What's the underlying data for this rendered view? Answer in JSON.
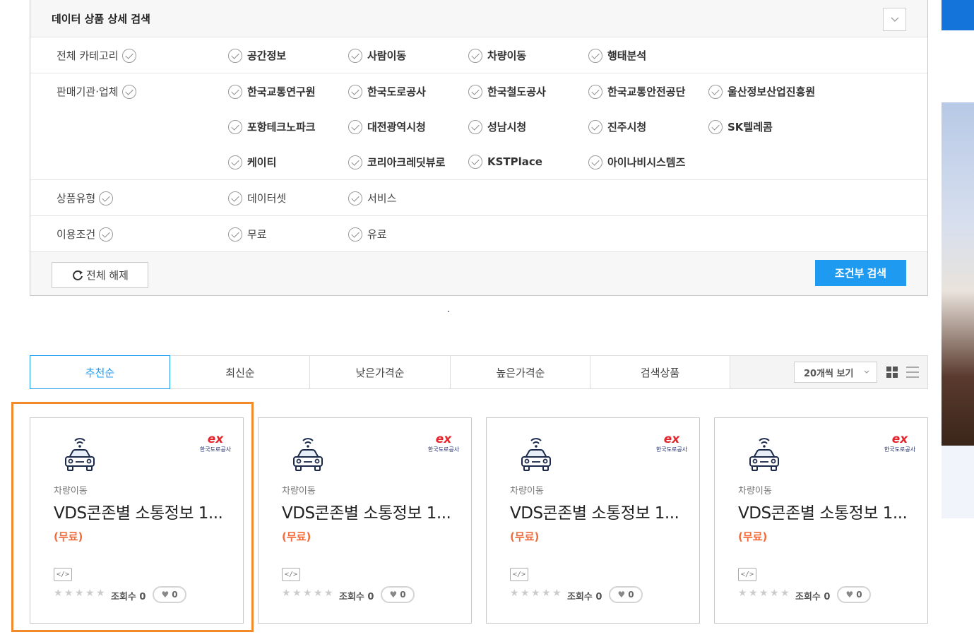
{
  "filter": {
    "title": "데이터 상품 상세 검색",
    "rows": [
      {
        "label": "전체 카테고리",
        "options": [
          "공간정보",
          "사람이동",
          "차량이동",
          "행태분석"
        ]
      },
      {
        "label": "판매기관·업체",
        "options": [
          "한국교통연구원",
          "한국도로공사",
          "한국철도공사",
          "한국교통안전공단",
          "울산정보산업진흥원",
          "포항테크노파크",
          "대전광역시청",
          "성남시청",
          "진주시청",
          "SK텔레콤",
          "케이티",
          "코리아크레딧뷰로",
          "KSTPlace",
          "아이나비시스템즈"
        ]
      },
      {
        "label": "상품유형",
        "options": [
          "데이터셋",
          "서비스"
        ]
      },
      {
        "label": "이용조건",
        "options": [
          "무료",
          "유료"
        ]
      }
    ],
    "reset_label": "전체 해제",
    "search_label": "조건부 검색"
  },
  "sort": {
    "tabs": [
      "추천순",
      "최신순",
      "낮은가격순",
      "높은가격순",
      "검색상품"
    ],
    "active_index": 0,
    "per_page": "20개씩 보기"
  },
  "cards": [
    {
      "brand": "한국도로공사",
      "category": "차량이동",
      "title": "VDS콘존별 소통정보 1...",
      "price": "(무료)",
      "api": "</>",
      "views": "조회수 0",
      "likes": "0"
    },
    {
      "brand": "한국도로공사",
      "category": "차량이동",
      "title": "VDS콘존별 소통정보 1...",
      "price": "(무료)",
      "api": "</>",
      "views": "조회수 0",
      "likes": "0"
    },
    {
      "brand": "한국도로공사",
      "category": "차량이동",
      "title": "VDS콘존별 소통정보 1...",
      "price": "(무료)",
      "api": "</>",
      "views": "조회수 0",
      "likes": "0"
    },
    {
      "brand": "한국도로공사",
      "category": "차량이동",
      "title": "VDS콘존별 소통정보 1...",
      "price": "(무료)",
      "api": "</>",
      "views": "조회수 0",
      "likes": "0"
    }
  ],
  "colors": {
    "accent": "#1e9af0",
    "price": "#f26b3a",
    "brand_red": "#e3262c",
    "highlight": "#f08a2a"
  },
  "icons": {
    "check": "check-circle-icon",
    "collapse": "chevron-down-icon",
    "reset": "refresh-icon",
    "car": "connected-car-icon",
    "api": "code-icon",
    "star": "star-icon",
    "heart": "heart-icon",
    "grid": "grid-view-icon",
    "list": "list-view-icon"
  }
}
